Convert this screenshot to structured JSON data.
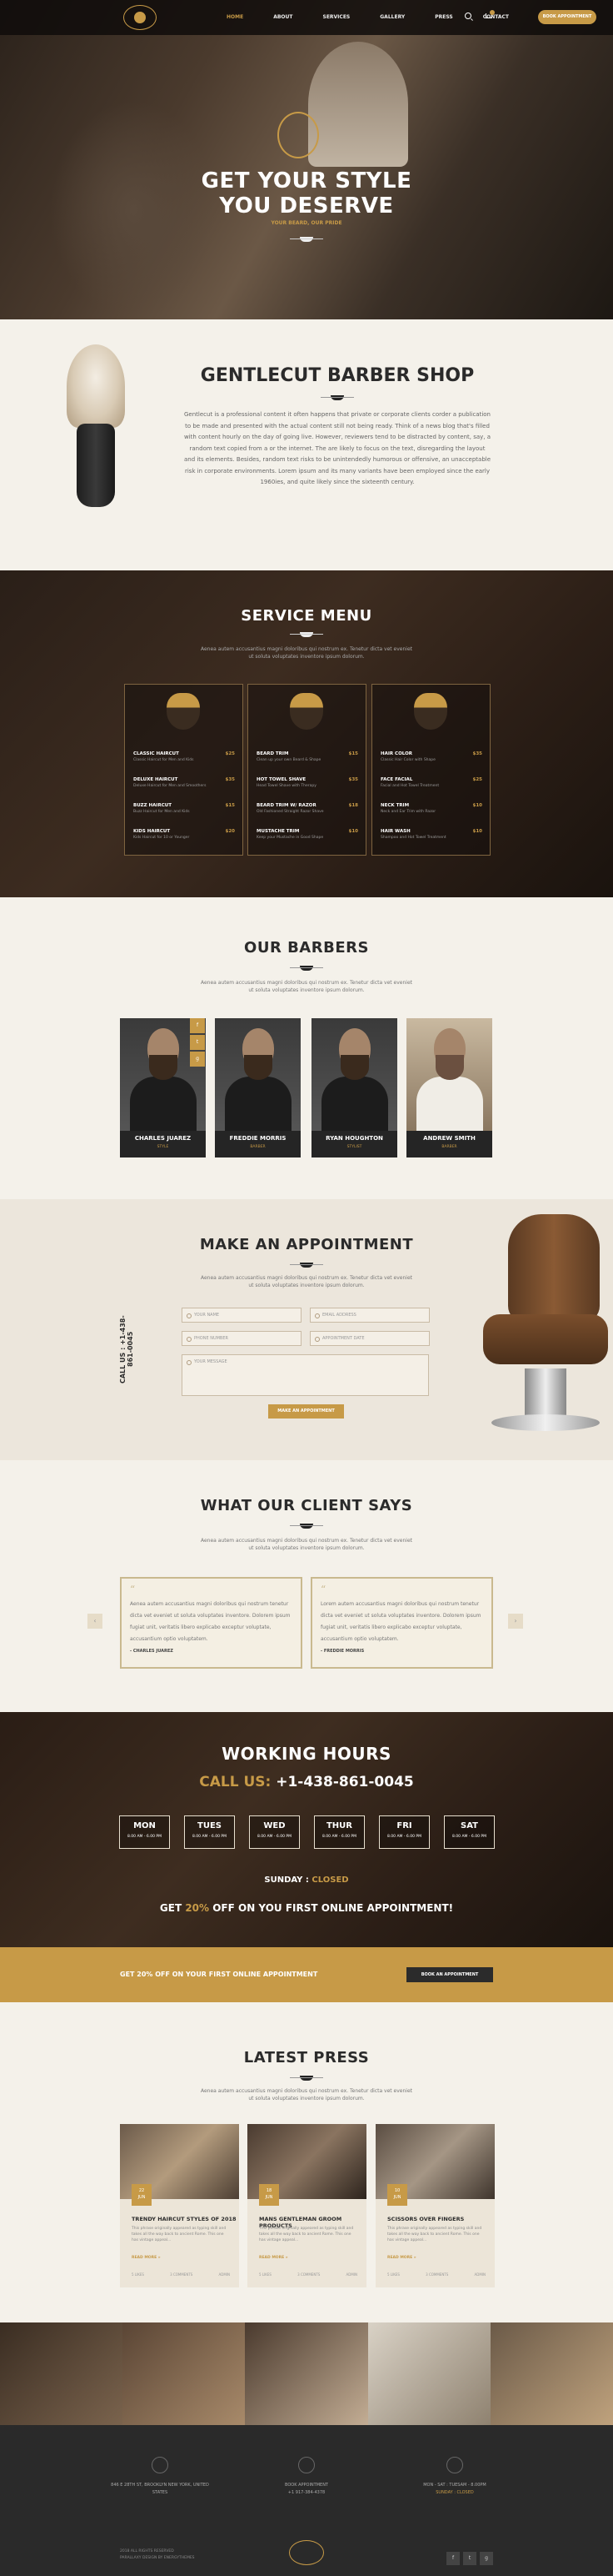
{
  "header": {
    "nav": [
      "HOME",
      "ABOUT",
      "SERVICES",
      "GALLERY",
      "PRESS",
      "CONTACT"
    ],
    "book_label": "BOOK APPOINTMENT"
  },
  "hero": {
    "title_line1": "GET YOUR STYLE",
    "title_line2": "YOU DESERVE",
    "subtitle": "YOUR BEARD, OUR PRIDE"
  },
  "about": {
    "title": "GENTLECUT BARBER SHOP",
    "text": "Gentlecut is a professional content it often happens that private or corporate clients corder a publication to be made and presented with the actual content still not being ready. Think of a news blog that's filled with content hourly on the day of going live. However, reviewers tend to be distracted by content, say, a random text copied from a or the internet. The are likely to focus on the text, disregarding the layout and its elements. Besides, random text risks to be unintendedly humorous or offensive, an unacceptable risk in corporate environments. Lorem ipsum and its many variants have been employed since the early 1960ies, and quite likely since the sixteenth century."
  },
  "services": {
    "title": "SERVICE MENU",
    "subtitle": "Aenea autem accusantius magni doloribus qui nostrum ex. Tenetur dicta vet eveniet ut soluta voluptates inventore ipsum dolorum.",
    "columns": [
      [
        {
          "name": "CLASSIC HAIRCUT",
          "price": "$25",
          "desc": "Classic Haircut for Men and Kids"
        },
        {
          "name": "DELUXE HAIRCUT",
          "price": "$35",
          "desc": "Deluxe Haircut for Men and Smoothers"
        },
        {
          "name": "BUZZ HAIRCUT",
          "price": "$15",
          "desc": "Buzz Haircut for Men and Kids"
        },
        {
          "name": "KIDS HAIRCUT",
          "price": "$20",
          "desc": "Kids Haircut for 10 or Younger"
        }
      ],
      [
        {
          "name": "BEARD TRIM",
          "price": "$15",
          "desc": "Clean up your own Beard & Shape"
        },
        {
          "name": "HOT TOWEL SHAVE",
          "price": "$35",
          "desc": "Head Towel Shave with Therapy"
        },
        {
          "name": "BEARD TRIM W/ RAZOR",
          "price": "$18",
          "desc": "Old Fashioned Straight Razor Shave"
        },
        {
          "name": "MUSTACHE TRIM",
          "price": "$10",
          "desc": "Keep your Mustache in Good Shape"
        }
      ],
      [
        {
          "name": "HAIR COLOR",
          "price": "$35",
          "desc": "Classic Hair Color with Shape"
        },
        {
          "name": "FACE FACIAL",
          "price": "$25",
          "desc": "Facial and Hot Towel Treatment"
        },
        {
          "name": "NECK TRIM",
          "price": "$10",
          "desc": "Neck and Ear Trim with Razor"
        },
        {
          "name": "HAIR WASH",
          "price": "$10",
          "desc": "Shampoo and Hot Towel Treatment"
        }
      ]
    ]
  },
  "barbers": {
    "title": "OUR BARBERS",
    "subtitle": "Aenea autem accusantius magni doloribus qui nostrum ex. Tenetur dicta vet eveniet ut soluta voluptates inventore ipsum dolorum.",
    "list": [
      {
        "name": "CHARLES JUAREZ",
        "role": "STYLE"
      },
      {
        "name": "FREDDIE MORRIS",
        "role": "BARBER"
      },
      {
        "name": "RYAN HOUGHTON",
        "role": "STYLIST"
      },
      {
        "name": "ANDREW SMITH",
        "role": "BARBER"
      }
    ],
    "social": [
      "f",
      "t",
      "g"
    ]
  },
  "appointment": {
    "title": "MAKE AN APPOINTMENT",
    "subtitle": "Aenea autem accusantius magni doloribus qui nostrum ex. Tenetur dicta vet eveniet ut soluta voluptates inventore ipsum dolorum.",
    "call": "CALL US : +1-438-861-0045",
    "placeholders": {
      "name": "YOUR NAME",
      "email": "EMAIL ADDRESS",
      "phone": "PHONE NUMBER",
      "date": "APPOINTMENT DATE",
      "message": "YOUR MESSAGE"
    },
    "button": "MAKE AN APPOINTMENT"
  },
  "testimonials": {
    "title": "WHAT OUR CLIENT SAYS",
    "subtitle": "Aenea autem accusantius magni doloribus qui nostrum ex. Tenetur dicta vet eveniet ut soluta voluptates inventore ipsum dolorum.",
    "items": [
      {
        "text": "Aenea autem accusantius magni doloribus qui nostrum tenetur dicta vet eveniet ut soluta voluptates inventore. Dolorem ipsum fugiat unit, veritatis libero explicabo exceptur voluptate, accusantium optio voluptatem.",
        "author": "- CHARLES JUAREZ"
      },
      {
        "text": "Lorem autem accusantius magni doloribus qui nostrum tenetur dicta vet eveniet ut soluta voluptates inventore. Dolorem ipsum fugiat unit, veritatis libero explicabo exceptur voluptate, accusantium optio voluptatem.",
        "author": "- FREDDIE MORRIS"
      }
    ],
    "prev": "‹",
    "next": "›"
  },
  "hours": {
    "title": "WORKING HOURS",
    "call_label": "CALL US:",
    "call_number": "+1-438-861-0045",
    "days": [
      {
        "day": "MON",
        "time": "8.00 AM - 6.00 PM"
      },
      {
        "day": "TUES",
        "time": "8.00 AM - 6.00 PM"
      },
      {
        "day": "WED",
        "time": "8.00 AM - 6.00 PM"
      },
      {
        "day": "THUR",
        "time": "8.00 AM - 6.00 PM"
      },
      {
        "day": "FRI",
        "time": "8.00 AM - 6.00 PM"
      },
      {
        "day": "SAT",
        "time": "8.00 AM - 6.00 PM"
      }
    ],
    "sunday_label": "SUNDAY :",
    "sunday_value": "CLOSED",
    "offer_pre": "GET",
    "offer_pct": "20%",
    "offer_post": "OFF ON YOU FIRST ONLINE APPOINTMENT!"
  },
  "banner": {
    "text": "GET 20% OFF ON YOUR FIRST ONLINE APPOINTMENT",
    "button": "BOOK AN APPOINTMENT"
  },
  "press": {
    "title": "LATEST PRESS",
    "subtitle": "Aenea autem accusantius magni doloribus qui nostrum ex. Tenetur dicta vet eveniet ut soluta voluptates inventore ipsum dolorum.",
    "items": [
      {
        "day": "22",
        "mon": "JUN",
        "title": "TRENDY HAIRCUT STYLES OF 2018",
        "body": "This phrase originally appeared as typing skill and takes all the way back to ancient Rome. This one has vintage appeal...",
        "more": "READ MORE »",
        "meta": [
          "5 LIKES",
          "3 COMMENTS",
          "ADMIN"
        ]
      },
      {
        "day": "18",
        "mon": "JUN",
        "title": "MANS GENTLEMAN GROOM PRODUCTS",
        "body": "This phrase originally appeared as typing skill and takes all the way back to ancient Rome. This one has vintage appeal...",
        "more": "READ MORE »",
        "meta": [
          "5 LIKES",
          "3 COMMENTS",
          "ADMIN"
        ]
      },
      {
        "day": "10",
        "mon": "JUN",
        "title": "SCISSORS OVER FINGERS",
        "body": "This phrase originally appeared as typing skill and takes all the way back to ancient Rome. This one has vintage appeal...",
        "more": "READ MORE »",
        "meta": [
          "5 LIKES",
          "3 COMMENTS",
          "ADMIN"
        ]
      }
    ]
  },
  "footer": {
    "address": "846 E 28TH ST, BROOKLYN NEW YORK, UNITED STATES",
    "phone_label": "BOOK APPOINTMENT",
    "phone": "+1 917-384-4378",
    "hours": "MON - SAT : TUESAM - 8.00PM",
    "sunday": "SUNDAY : CLOSED",
    "copy1": "2018 ALL RIGHTS RESERVED",
    "copy2": "PARALLAXY DESIGN BY ENERGYTHEMES",
    "social": [
      "f",
      "t",
      "g"
    ]
  },
  "colors": {
    "accent": "#c79a47",
    "dark": "#2b2b2b",
    "cream": "#f4f1ea"
  }
}
